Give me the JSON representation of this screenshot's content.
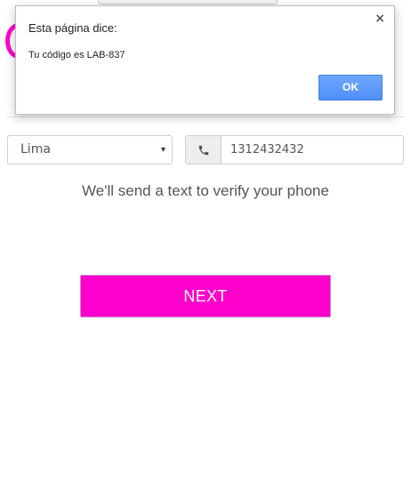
{
  "dialog": {
    "title": "Esta página dice:",
    "message": "Tu código es LAB-837",
    "ok_label": "OK",
    "close_glyph": "×",
    "ok_color": "#5a9bff"
  },
  "form": {
    "city_value": "Lima",
    "caret_glyph": "▾",
    "phone_icon": "phone-icon",
    "phone_value": "1312432432",
    "verify_text": "We'll send a text to verify your phone",
    "next_label": "NEXT",
    "accent_color": "#ff00cc"
  }
}
